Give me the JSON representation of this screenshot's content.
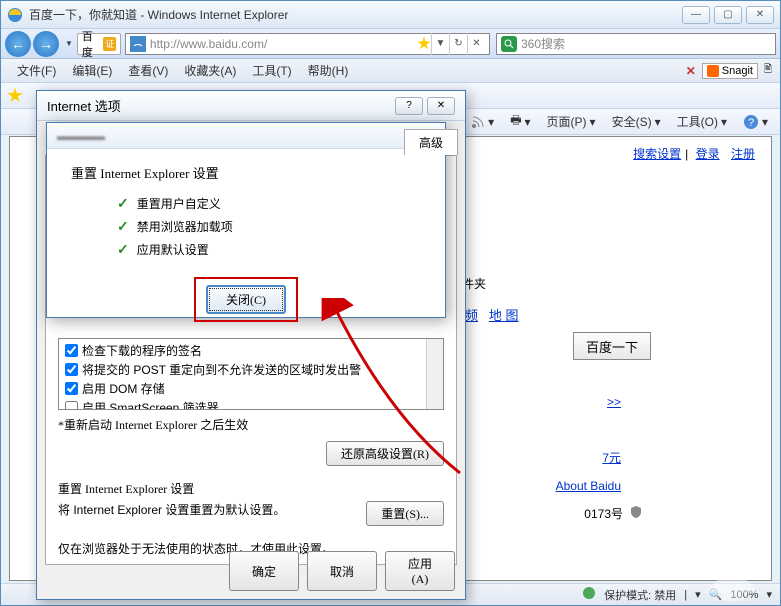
{
  "window": {
    "title": "百度一下，你就知道 - Windows Internet Explorer",
    "min": "—",
    "max": "▢",
    "close": "✕"
  },
  "nav": {
    "back": "←",
    "fwd": "→",
    "fav_label": "百度",
    "fav_badge": "证",
    "url": "http://www.baidu.com/",
    "refresh": "↻",
    "stop": "✕",
    "search_placeholder": "360搜索"
  },
  "menu": {
    "items": [
      "文件(F)",
      "编辑(E)",
      "查看(V)",
      "收藏夹(A)",
      "工具(T)",
      "帮助(H)"
    ],
    "close_tabs_icon": "✕",
    "snagit": "Snagit",
    "snagit_icon_color": "#ff6600"
  },
  "cmdbar": {
    "home_icon": "⌂",
    "print_icon": "🖶",
    "page": "页面(P)",
    "safety": "安全(S)",
    "tools": "工具(O)",
    "help_icon": "?"
  },
  "content": {
    "links_right": [
      "搜索设置",
      "登录",
      "注册"
    ],
    "categories": [
      "频",
      "地 图"
    ],
    "search_btn": "百度一下",
    "link_027": "7元",
    "about": "About Baidu",
    "icp": "0173号",
    "folder_label": "文件夹"
  },
  "dialog_options": {
    "title": "Internet 选项",
    "help": "?",
    "close": "✕",
    "tab_advanced": "高级",
    "settings": [
      {
        "checked": true,
        "label": "检查下载的程序的签名"
      },
      {
        "checked": true,
        "label": "将提交的 POST 重定向到不允许发送的区域时发出警"
      },
      {
        "checked": true,
        "label": "启用 DOM 存储"
      },
      {
        "checked": false,
        "label": "启用 SmartScreen 筛选器"
      }
    ],
    "restart_note": "*重新启动 Internet Explorer 之后生效",
    "restore_btn": "还原高级设置(R)",
    "reset_heading": "重置 Internet Explorer 设置",
    "reset_desc": "将 Internet Explorer 设置重置为默认设置。",
    "reset_btn": "重置(S)...",
    "reset_warning": "仅在浏览器处于无法使用的状态时，才使用此设置。",
    "ok": "确定",
    "cancel": "取消",
    "apply": "应用(A)"
  },
  "dialog_reset": {
    "title_blur": "重置 Internet Explorer 设置",
    "heading": "重置 Internet Explorer 设置",
    "items": [
      "重置用户自定义",
      "禁用浏览器加载项",
      "应用默认设置"
    ],
    "close_btn": "关闭(C)"
  },
  "statusbar": {
    "protected": "保护模式: 禁用",
    "zoom": "100%"
  },
  "colors": {
    "highlight_red": "#cc0000",
    "link_blue": "#0033cc"
  }
}
